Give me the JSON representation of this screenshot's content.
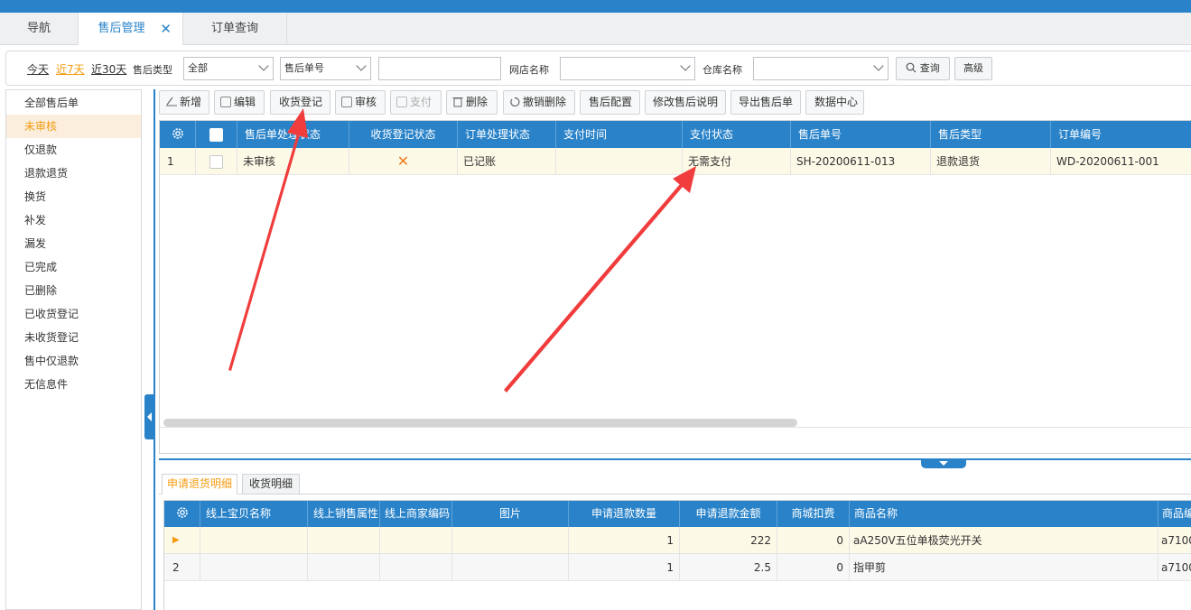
{
  "tabs": [
    {
      "label": "导航"
    },
    {
      "label": "售后管理"
    },
    {
      "label": "订单查询"
    }
  ],
  "filter": {
    "today": "今天",
    "last7": "近7天",
    "last30": "近30天",
    "type_label": "售后类型",
    "type_value": "全部",
    "field_select": "售后单号",
    "search_value": "",
    "shop_label": "网店名称",
    "shop_value": "",
    "warehouse_label": "仓库名称",
    "warehouse_value": "",
    "query_button": "查询",
    "advanced_button": "高级"
  },
  "sidebar": {
    "items": [
      {
        "label": "全部售后单"
      },
      {
        "label": "未审核"
      },
      {
        "label": "仅退款"
      },
      {
        "label": "退款退货"
      },
      {
        "label": "换货"
      },
      {
        "label": "补发"
      },
      {
        "label": "漏发"
      },
      {
        "label": "已完成"
      },
      {
        "label": "已删除"
      },
      {
        "label": "已收货登记"
      },
      {
        "label": "未收货登记"
      },
      {
        "label": "售中仅退款"
      },
      {
        "label": "无信息件"
      }
    ]
  },
  "toolbar": {
    "add": "新增",
    "edit": "编辑",
    "receive": "收货登记",
    "audit": "审核",
    "pay": "支付",
    "delete": "删除",
    "undelete": "撤销删除",
    "config": "售后配置",
    "modify_note": "修改售后说明",
    "export": "导出售后单",
    "data_center": "数据中心"
  },
  "main_grid": {
    "columns": [
      "售后单处理状态",
      "收货登记状态",
      "订单处理状态",
      "支付时间",
      "支付状态",
      "售后单号",
      "售后类型",
      "订单编号"
    ],
    "rows": [
      {
        "index": "1",
        "status": "未审核",
        "receive_status": "✕",
        "order_status": "已记账",
        "pay_time": "",
        "pay_status": "无需支付",
        "aftersale_no": "SH-20200611-013",
        "aftersale_type": "退款退货",
        "order_no": "WD-20200611-001"
      }
    ]
  },
  "detail_tabs": [
    {
      "label": "申请退货明细"
    },
    {
      "label": "收货明细"
    }
  ],
  "detail_grid": {
    "columns": [
      "线上宝贝名称",
      "线上销售属性",
      "线上商家编码",
      "图片",
      "申请退款数量",
      "申请退款金额",
      "商城扣费",
      "商品名称",
      "商品编"
    ],
    "rows": [
      {
        "index": "▶",
        "qty": "1",
        "amount": "222",
        "fee": "0",
        "name": "aA250V五位单极荧光开关",
        "code": "a7100"
      },
      {
        "index": "2",
        "qty": "1",
        "amount": "2.5",
        "fee": "0",
        "name": "指甲剪",
        "code": "a7100"
      }
    ]
  },
  "colors": {
    "accent": "#2a83c9",
    "highlight": "#f39c12",
    "annotation_arrow": "#f03c3c"
  }
}
